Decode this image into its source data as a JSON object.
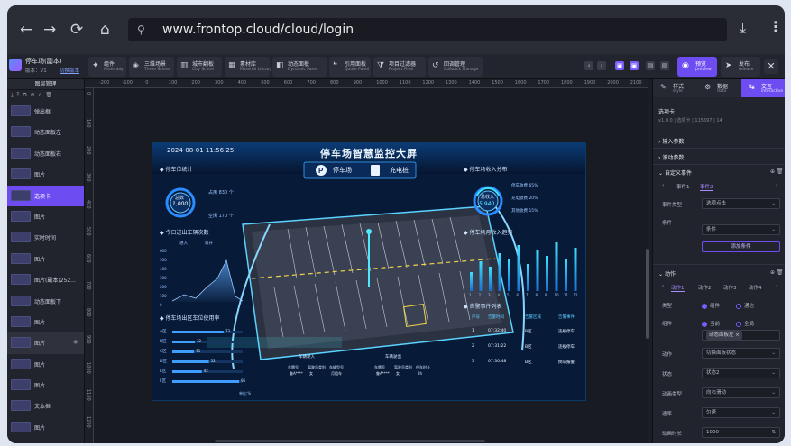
{
  "browser": {
    "url": "www.frontop.cloud/cloud/login"
  },
  "toolbar": {
    "project_name": "停车场(副本)",
    "project_version": "版本：V1",
    "project_link": "切换版本",
    "buttons": [
      {
        "zh": "组件",
        "en": "Assembly",
        "icon": "puzzle-icon"
      },
      {
        "zh": "三维场景",
        "en": "Three Scene",
        "icon": "cube-icon"
      },
      {
        "zh": "城市翻板",
        "en": "City Scene",
        "icon": "building-icon"
      },
      {
        "zh": "素材库",
        "en": "Material Library",
        "icon": "grid-icon"
      },
      {
        "zh": "动态面板",
        "en": "Dynamic Panel",
        "icon": "layers-icon"
      },
      {
        "zh": "引用面板",
        "en": "Quote Panel",
        "icon": "quote-icon"
      },
      {
        "zh": "项目过滤器",
        "en": "Project Filter",
        "icon": "filter-icon"
      },
      {
        "zh": "回调管理",
        "en": "Callback Manage",
        "icon": "callback-icon"
      }
    ],
    "preview": {
      "zh": "预览",
      "en": "preview"
    },
    "publish": {
      "zh": "发布",
      "en": "release"
    }
  },
  "layers": {
    "title": "图层管理",
    "items": [
      {
        "name": "弹出框",
        "state": ""
      },
      {
        "name": "动态面板左",
        "state": ""
      },
      {
        "name": "动态面板右",
        "state": ""
      },
      {
        "name": "图片",
        "state": ""
      },
      {
        "name": "选项卡",
        "state": "selected"
      },
      {
        "name": "图片",
        "state": ""
      },
      {
        "name": "实时时间",
        "state": ""
      },
      {
        "name": "图片",
        "state": ""
      },
      {
        "name": "图片(副本)252...",
        "state": ""
      },
      {
        "name": "动态面板下",
        "state": ""
      },
      {
        "name": "图片",
        "state": ""
      },
      {
        "name": "图片",
        "state": "hover"
      },
      {
        "name": "图片",
        "state": ""
      },
      {
        "name": "图片",
        "state": ""
      },
      {
        "name": "文本框",
        "state": ""
      },
      {
        "name": "图片",
        "state": ""
      }
    ]
  },
  "ruler": {
    "ticks": [
      "-200",
      "-100",
      "0",
      "100",
      "200",
      "300",
      "400",
      "500",
      "600",
      "700",
      "800",
      "900",
      "1000",
      "1100",
      "1200",
      "1300",
      "1400",
      "1500",
      "1600",
      "1700",
      "1800",
      "1900",
      "2000",
      "2100"
    ],
    "vticks": [
      "0",
      "100",
      "200",
      "300",
      "400",
      "500",
      "600",
      "700",
      "800",
      "900",
      "1000",
      "1100",
      "1200"
    ]
  },
  "dashboard": {
    "datetime": "2024-08-01  11:56:25",
    "title": "停车场智慧监控大屏",
    "tab_parking": "停车场",
    "tab_charging": "充电桩",
    "sec_stats": "停车位统计",
    "total_label": "总数",
    "total_value": "1,000",
    "occupied_label": "占用",
    "occupied_value": "830",
    "idle_label": "空闲",
    "idle_value": "170",
    "unit": "个",
    "sec_traffic": "今日进出车辆次数",
    "legend_in": "进入",
    "legend_out": "离开",
    "yaxis": [
      "600",
      "500",
      "400",
      "300",
      "200",
      "100",
      "0"
    ],
    "sec_rate": "停车场出区车位使用率",
    "rate_rows": [
      {
        "label": "A区",
        "value": "73",
        "pct": 0.73
      },
      {
        "label": "B区",
        "value": "32",
        "pct": 0.32
      },
      {
        "label": "C区",
        "value": "31",
        "pct": 0.31
      },
      {
        "label": "D区",
        "value": "52",
        "pct": 0.52
      },
      {
        "label": "E区",
        "value": "42",
        "pct": 0.42
      },
      {
        "label": "F区",
        "value": "95",
        "pct": 0.95
      }
    ],
    "rate_unit": "单位:%",
    "sec_income": "停车场收入分布",
    "income_label": "总收入",
    "income_value": "5,940",
    "income_rows": [
      {
        "label": "停车收费",
        "value": "65",
        "suffix": "%"
      },
      {
        "label": "充电收费",
        "value": "20",
        "suffix": "%"
      },
      {
        "label": "其他收费",
        "value": "15",
        "suffix": "%"
      }
    ],
    "sec_trend": "停车场月收入趋势",
    "trend_bars": [
      0.35,
      0.55,
      0.45,
      0.7,
      0.6,
      0.85,
      0.5,
      0.75,
      0.65,
      0.9,
      0.6,
      0.8
    ],
    "trend_months": [
      "1",
      "2",
      "3",
      "4",
      "5",
      "6",
      "7",
      "8",
      "9",
      "10",
      "11",
      "12"
    ],
    "sec_alarm": "告警事件列表",
    "alarm_headers": [
      "序号",
      "告警时间",
      "告警区域",
      "告警事件"
    ],
    "alarm_rows": [
      [
        "1",
        "07:32:40",
        "B区",
        "违规停车"
      ],
      [
        "2",
        "07:31:22",
        "B区",
        "违规停车"
      ],
      [
        "3",
        "07:30:48",
        "B区",
        "倒车报警"
      ]
    ],
    "car_in": "车辆驶入",
    "car_out": "车辆驶出",
    "car_rows": [
      {
        "plate_label": "车牌号",
        "plate": "鲁A****",
        "person_label": "驾驶员类别",
        "person": "女",
        "spot_label": "车辆型号",
        "spot": "月租车"
      },
      {
        "plate_label": "车牌号",
        "plate": "鲁A****",
        "person_label": "驾驶员类别",
        "person": "女",
        "spot_label": "停车时长",
        "spot": "2h"
      }
    ]
  },
  "panel": {
    "tabs": [
      {
        "zh": "样式",
        "en": "style"
      },
      {
        "zh": "数据",
        "en": "data"
      },
      {
        "zh": "交互",
        "en": "interactive"
      }
    ],
    "component_name": "选项卡",
    "component_meta": "v1.0.0 | 选项卡 | 115697 | 14",
    "sections": [
      "输入参数",
      "滚动参数"
    ],
    "custom_events": "自定义事件",
    "event_tabs": [
      "事件1",
      "事件2"
    ],
    "event_type_label": "事件类型",
    "event_type_value": "选项点击",
    "condition_label": "条件",
    "condition_value": "条件",
    "add_condition": "添加条件",
    "action_title": "动作",
    "action_tabs": [
      "动作1",
      "动作2",
      "动作3",
      "动作4"
    ],
    "type_label": "类型",
    "type_options": [
      "组件",
      "通信"
    ],
    "component_label": "组件",
    "component_options": [
      "当前",
      "全局"
    ],
    "component_chip": "动态面板左",
    "action_label": "动作",
    "action_value": "切换面板状态",
    "state_label": "状态",
    "state_value": "状态2",
    "anim_label": "动画类型",
    "anim_value": "向右滑动",
    "speed_label": "速率",
    "speed_value": "匀速",
    "duration_label": "动画时长",
    "duration_value": "1000"
  }
}
